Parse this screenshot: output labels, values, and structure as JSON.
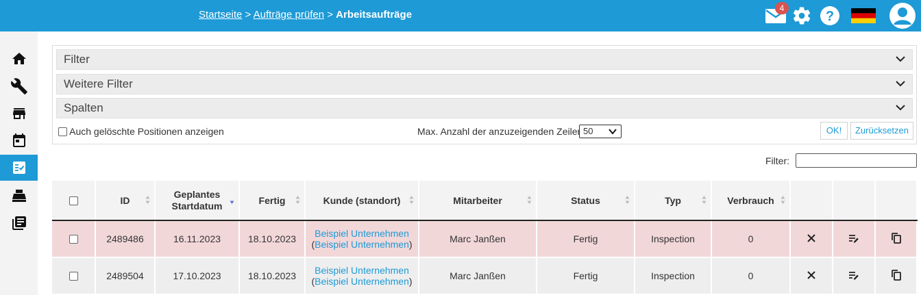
{
  "breadcrumb": {
    "home": "Startseite",
    "sep1": ">",
    "check": "Aufträge prüfen",
    "sep2": ">",
    "current": "Arbeitsaufträge"
  },
  "header": {
    "mail_count": "4",
    "flag": "de-flag"
  },
  "sidebar": {
    "items": [
      "home-icon",
      "wrench-icon",
      "store-icon",
      "calendar-icon",
      "checklist-icon",
      "printer-icon",
      "library-icon"
    ],
    "active_index": 4
  },
  "filters": {
    "accordions": [
      "Filter",
      "Weitere Filter",
      "Spalten"
    ],
    "show_deleted_label": "Auch gelöschte Positionen anzeigen",
    "max_rows_label": "Max. Anzahl der anzuzeigenden Zeilen",
    "max_rows_value": "50",
    "ok_label": "OK!",
    "reset_label": "Zurücksetzen"
  },
  "table_filter": {
    "label": "Filter:",
    "value": ""
  },
  "table": {
    "headers": [
      "ID",
      "Geplantes Startdatum",
      "Fertig",
      "Kunde (standort)",
      "Mitarbeiter",
      "Status",
      "Typ",
      "Verbrauch"
    ],
    "rows": [
      {
        "id": "2489486",
        "start": "16.11.2023",
        "fertig": "18.10.2023",
        "kunde": "Beispiel Unternehmen",
        "standort": "Beispiel Unternehmen",
        "mitarbeiter": "Marc Janßen",
        "status": "Fertig",
        "typ": "Inspection",
        "verbrauch": "0"
      },
      {
        "id": "2489504",
        "start": "17.10.2023",
        "fertig": "18.10.2023",
        "kunde": "Beispiel Unternehmen",
        "standort": "Beispiel Unternehmen",
        "mitarbeiter": "Marc Janßen",
        "status": "Fertig",
        "typ": "Inspection",
        "verbrauch": "0"
      }
    ]
  },
  "colors": {
    "primary": "#1e9ad6",
    "row_highlight": "#f2d7d9",
    "badge": "#d9534f"
  }
}
